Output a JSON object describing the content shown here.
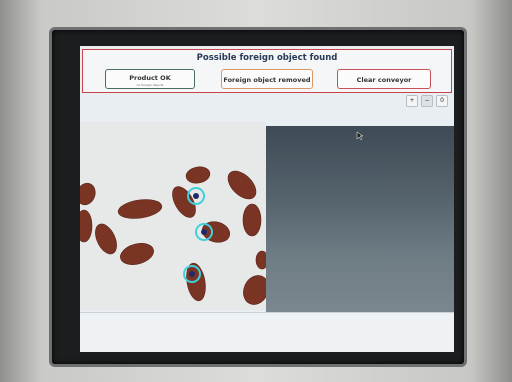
{
  "alert": {
    "title": "Possible foreign object found",
    "buttons": {
      "product_ok": {
        "label": "Product OK",
        "sublabel": "no foreign objects"
      },
      "object_removed": {
        "label": "Foreign object removed"
      },
      "clear_conveyor": {
        "label": "Clear conveyor"
      }
    }
  },
  "view_controls": {
    "zoom_in": "+",
    "zoom_out": "−",
    "reset": "0"
  },
  "colors": {
    "alert_border": "#c8434a",
    "title_text": "#2a3b57",
    "detection_ring": "#3fd0dc"
  }
}
